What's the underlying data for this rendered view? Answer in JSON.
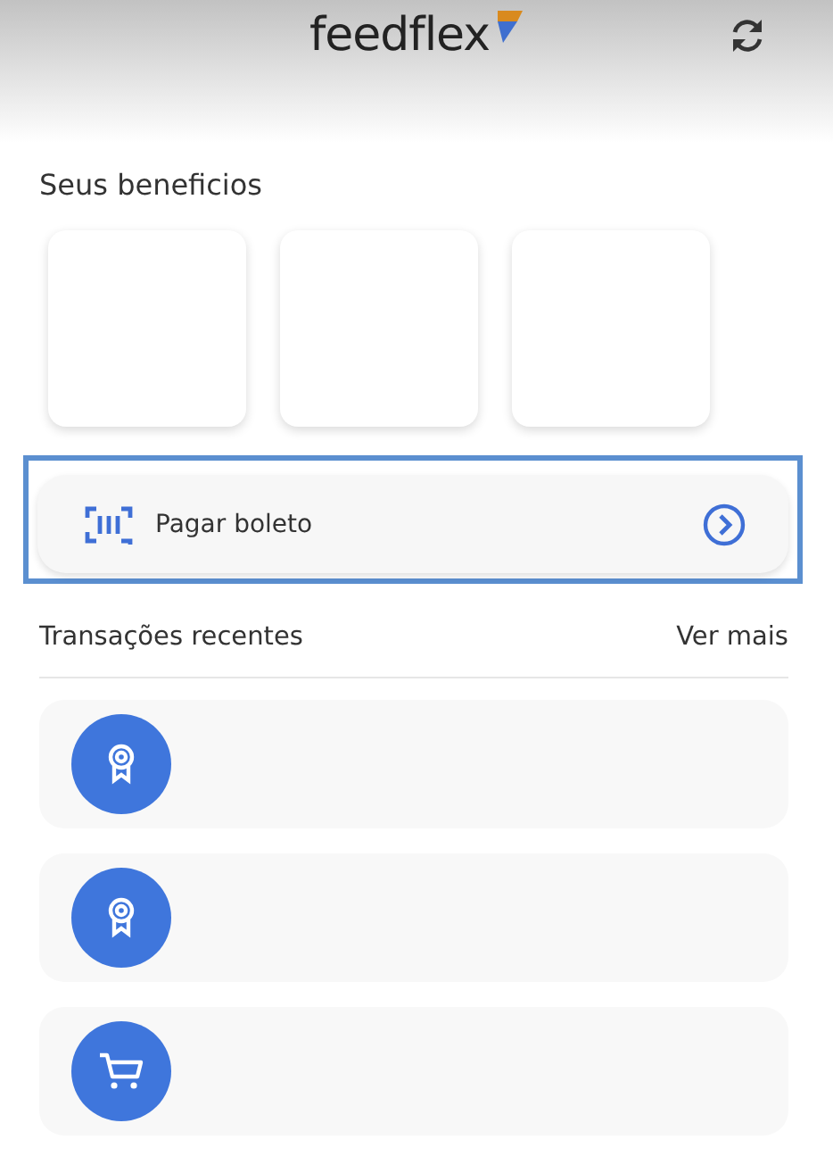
{
  "header": {
    "logo": "feedflex"
  },
  "benefits": {
    "title": "Seus beneficios",
    "cards": [
      {
        "kind": "blank"
      },
      {
        "kind": "blank"
      },
      {
        "kind": "blank"
      }
    ]
  },
  "boleto": {
    "label": "Pagar boleto",
    "focused": true
  },
  "transactions": {
    "title": "Transações recentes",
    "more": "Ver mais",
    "items": [
      {
        "kind": "award"
      },
      {
        "kind": "award"
      },
      {
        "kind": "cart"
      }
    ]
  }
}
